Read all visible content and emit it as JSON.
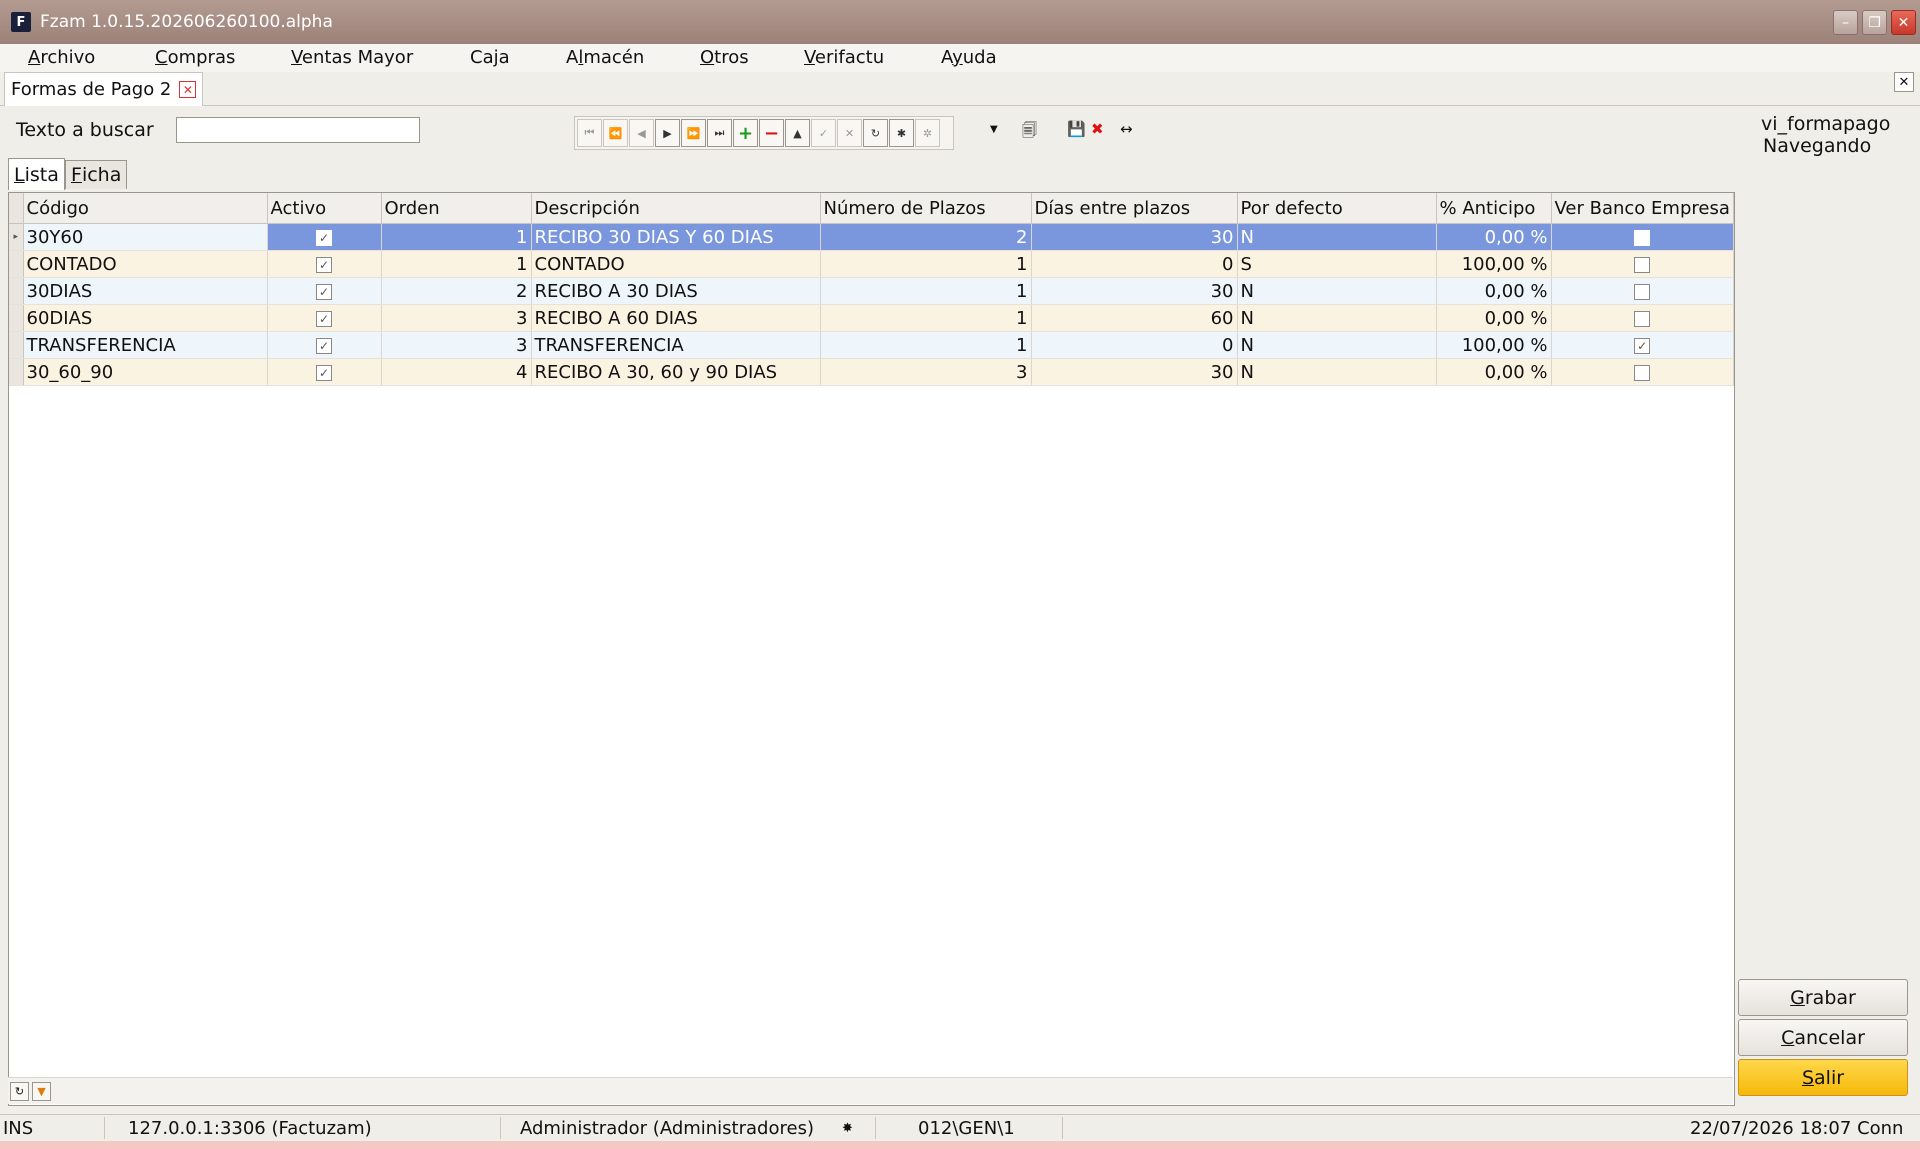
{
  "window": {
    "title": "Fzam 1.0.15.202606260100.alpha",
    "icon": "F",
    "controls": [
      "minimize-icon",
      "restore-icon",
      "close-icon"
    ]
  },
  "menu": [
    {
      "pre": "",
      "ul": "A",
      "post": "rchivo"
    },
    {
      "pre": "",
      "ul": "C",
      "post": "ompras"
    },
    {
      "pre": "",
      "ul": "V",
      "post": "entas Mayor"
    },
    {
      "pre": "Ca",
      "ul": "j",
      "post": "a"
    },
    {
      "pre": "A",
      "ul": "l",
      "post": "macén"
    },
    {
      "pre": "",
      "ul": "O",
      "post": "tros"
    },
    {
      "pre": "",
      "ul": "V",
      "post": "erifactu"
    },
    {
      "pre": "A",
      "ul": "y",
      "post": "uda"
    }
  ],
  "doc_tab": {
    "label": "Formas de Pago 2"
  },
  "search": {
    "label": "Texto a buscar",
    "value": "",
    "placeholder": ""
  },
  "navigator": [
    "first",
    "prior-page",
    "prior",
    "next",
    "next-page",
    "last",
    "insert",
    "delete",
    "edit",
    "post",
    "cancel",
    "refresh",
    "apply",
    "cancel-updates"
  ],
  "status_info": {
    "table": "vi_formapago",
    "mode": "Navegando"
  },
  "tabs": [
    {
      "ul": "L",
      "post": "ista"
    },
    {
      "ul": "F",
      "post": "icha"
    }
  ],
  "grid": {
    "columns": [
      "Código",
      "Activo",
      "Orden",
      "Descripción",
      "Número de Plazos",
      "Días entre plazos",
      "Por defecto",
      "% Anticipo",
      "Ver Banco Empresa"
    ],
    "rows": [
      {
        "codigo": "30Y60",
        "activo": true,
        "orden": "1",
        "descripcion": "RECIBO 30 DIAS Y 60 DIAS",
        "plazos": "2",
        "dias": "30",
        "defecto": "N",
        "anticipo": "0,00 %",
        "ver_banco": false
      },
      {
        "codigo": "CONTADO",
        "activo": true,
        "orden": "1",
        "descripcion": "CONTADO",
        "plazos": "1",
        "dias": "0",
        "defecto": "S",
        "anticipo": "100,00 %",
        "ver_banco": false
      },
      {
        "codigo": "30DIAS",
        "activo": true,
        "orden": "2",
        "descripcion": "RECIBO A 30 DIAS",
        "plazos": "1",
        "dias": "30",
        "defecto": "N",
        "anticipo": "0,00 %",
        "ver_banco": false
      },
      {
        "codigo": "60DIAS",
        "activo": true,
        "orden": "3",
        "descripcion": "RECIBO A 60 DIAS",
        "plazos": "1",
        "dias": "60",
        "defecto": "N",
        "anticipo": "0,00 %",
        "ver_banco": false
      },
      {
        "codigo": "TRANSFERENCIA",
        "activo": true,
        "orden": "3",
        "descripcion": "TRANSFERENCIA",
        "plazos": "1",
        "dias": "0",
        "defecto": "N",
        "anticipo": "100,00 %",
        "ver_banco": true
      },
      {
        "codigo": "30_60_90",
        "activo": true,
        "orden": "4",
        "descripcion": "RECIBO A 30, 60 y 90 DIAS",
        "plazos": "3",
        "dias": "30",
        "defecto": "N",
        "anticipo": "0,00 %",
        "ver_banco": false
      }
    ]
  },
  "buttons": [
    {
      "name": "save-button",
      "ul": "G",
      "post": "rabar"
    },
    {
      "name": "cancel-button",
      "ul": "C",
      "post": "ancelar"
    },
    {
      "name": "exit-button",
      "ul": "S",
      "post": "alir"
    }
  ],
  "statusbar": {
    "mode": "INS",
    "connection": "127.0.0.1:3306 (Factuzam)",
    "user": "Administrador (Administradores)",
    "path": "012\\GEN\\1",
    "datetime": "22/07/2026 18:07 Conn"
  },
  "colors": {
    "selected_row": "#7a96dc",
    "row_even": "#eef5fb",
    "row_odd": "#fbf3e2",
    "exit_button": "#f5b80a",
    "titlebar": "#a88e85"
  }
}
